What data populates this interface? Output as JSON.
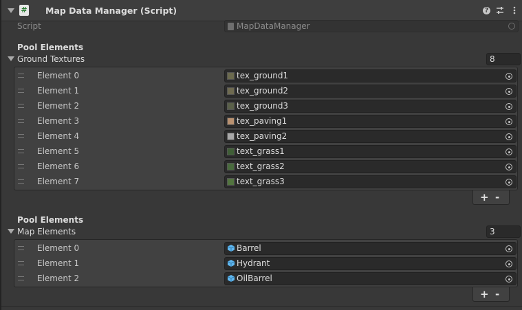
{
  "component": {
    "title": "Map Data Manager (Script)",
    "icon": "#",
    "script_label": "Script",
    "script_value": "MapDataManager"
  },
  "sections": [
    {
      "heading": "Pool Elements",
      "list_label": "Ground Textures",
      "size": "8",
      "items": [
        {
          "label": "Element 0",
          "value": "tex_ground1",
          "color": "#6b6a4e"
        },
        {
          "label": "Element 1",
          "value": "tex_ground2",
          "color": "#6e6a50"
        },
        {
          "label": "Element 2",
          "value": "tex_ground3",
          "color": "#5a6049"
        },
        {
          "label": "Element 3",
          "value": "tex_paving1",
          "color": "#b99170"
        },
        {
          "label": "Element 4",
          "value": "tex_paving2",
          "color": "#a8a8a8"
        },
        {
          "label": "Element 5",
          "value": "text_grass1",
          "color": "#3f5e36"
        },
        {
          "label": "Element 6",
          "value": "text_grass2",
          "color": "#496b3d"
        },
        {
          "label": "Element 7",
          "value": "text_grass3",
          "color": "#52743f"
        }
      ],
      "add_label": "+",
      "remove_label": "-"
    },
    {
      "heading": "Pool Elements",
      "list_label": "Map Elements",
      "size": "3",
      "items": [
        {
          "label": "Element 0",
          "value": "Barrel",
          "icon": "prefab-cube-icon"
        },
        {
          "label": "Element 1",
          "value": "Hydrant",
          "icon": "prefab-cube-icon"
        },
        {
          "label": "Element 2",
          "value": "OilBarrel",
          "icon": "prefab-cube-icon"
        }
      ],
      "add_label": "+",
      "remove_label": "-"
    }
  ],
  "colors": {
    "background": "#383838",
    "field": "#2a2a2a",
    "prefab": "#5fb7f0"
  }
}
